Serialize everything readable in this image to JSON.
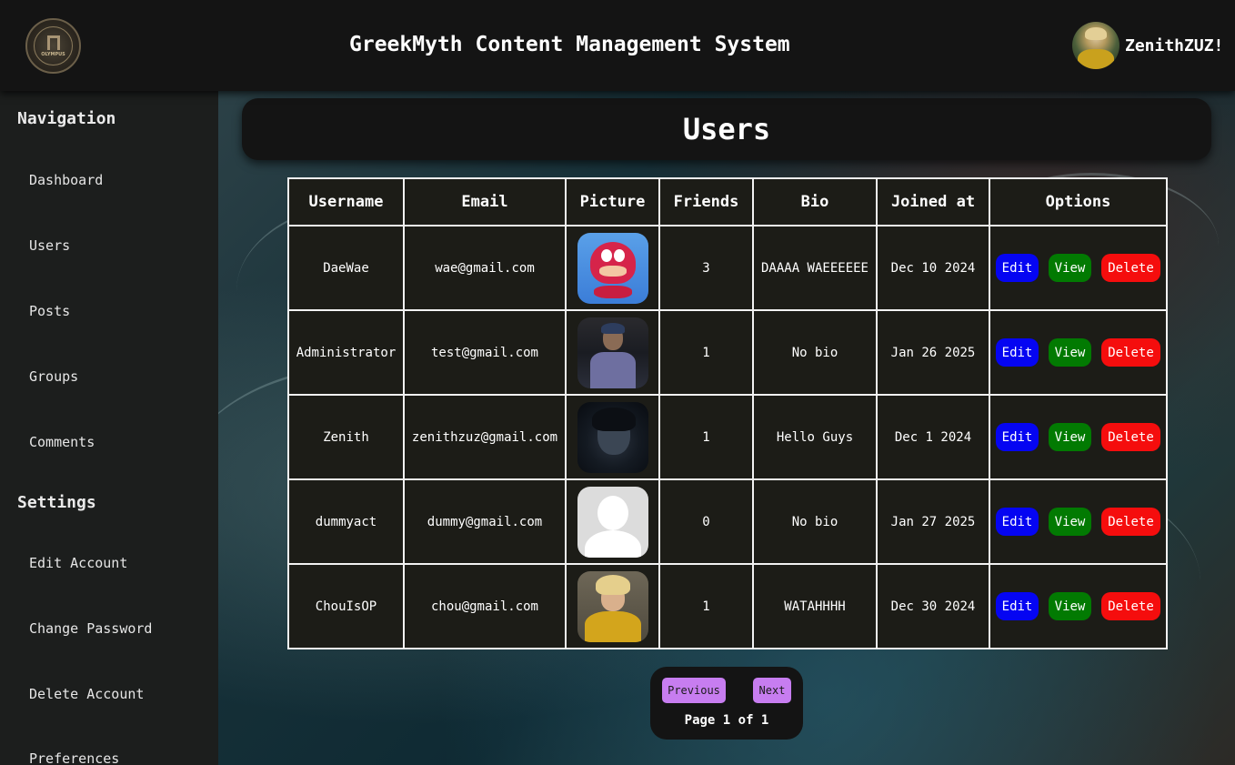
{
  "header": {
    "title": "GreekMyth Content Management System",
    "logo_text": "OLYMPUS",
    "username": "ZenithZUZ!"
  },
  "sidebar": {
    "nav_heading": "Navigation",
    "nav_items": [
      {
        "label": "Dashboard"
      },
      {
        "label": "Users"
      },
      {
        "label": "Posts"
      },
      {
        "label": "Groups"
      },
      {
        "label": "Comments"
      }
    ],
    "settings_heading": "Settings",
    "settings_items": [
      {
        "label": "Edit Account"
      },
      {
        "label": "Change Password"
      },
      {
        "label": "Delete Account"
      },
      {
        "label": "Preferences"
      }
    ]
  },
  "main": {
    "page_title": "Users",
    "table": {
      "headers": [
        "Username",
        "Email",
        "Picture",
        "Friends",
        "Bio",
        "Joined at",
        "Options"
      ],
      "rows": [
        {
          "username": "DaeWae",
          "email": "wae@gmail.com",
          "picture": "knuckles-avatar",
          "friends": "3",
          "bio": "DAAAA WAEEEEEE",
          "joined": "Dec 10 2024"
        },
        {
          "username": "Administrator",
          "email": "test@gmail.com",
          "picture": "person-photo",
          "friends": "1",
          "bio": "No bio",
          "joined": "Jan 26 2025"
        },
        {
          "username": "Zenith",
          "email": "zenithzuz@gmail.com",
          "picture": "anime-avatar",
          "friends": "1",
          "bio": "Hello Guys",
          "joined": "Dec 1 2024"
        },
        {
          "username": "dummyact",
          "email": "dummy@gmail.com",
          "picture": "default-avatar",
          "friends": "0",
          "bio": "No bio",
          "joined": "Jan 27 2025"
        },
        {
          "username": "ChouIsOP",
          "email": "chou@gmail.com",
          "picture": "game-hero-avatar",
          "friends": "1",
          "bio": "WATAHHHH",
          "joined": "Dec 30 2024"
        }
      ],
      "options": {
        "edit": "Edit",
        "view": "View",
        "delete": "Delete"
      }
    },
    "pagination": {
      "previous": "Previous",
      "next": "Next",
      "info": "Page 1 of 1"
    }
  },
  "colors": {
    "header_bg": "#141414",
    "sidebar_bg": "#1c1e1d",
    "edit": "#0505f2",
    "view": "#027a02",
    "delete": "#f50d0d",
    "pager_button": "#c77df0"
  }
}
